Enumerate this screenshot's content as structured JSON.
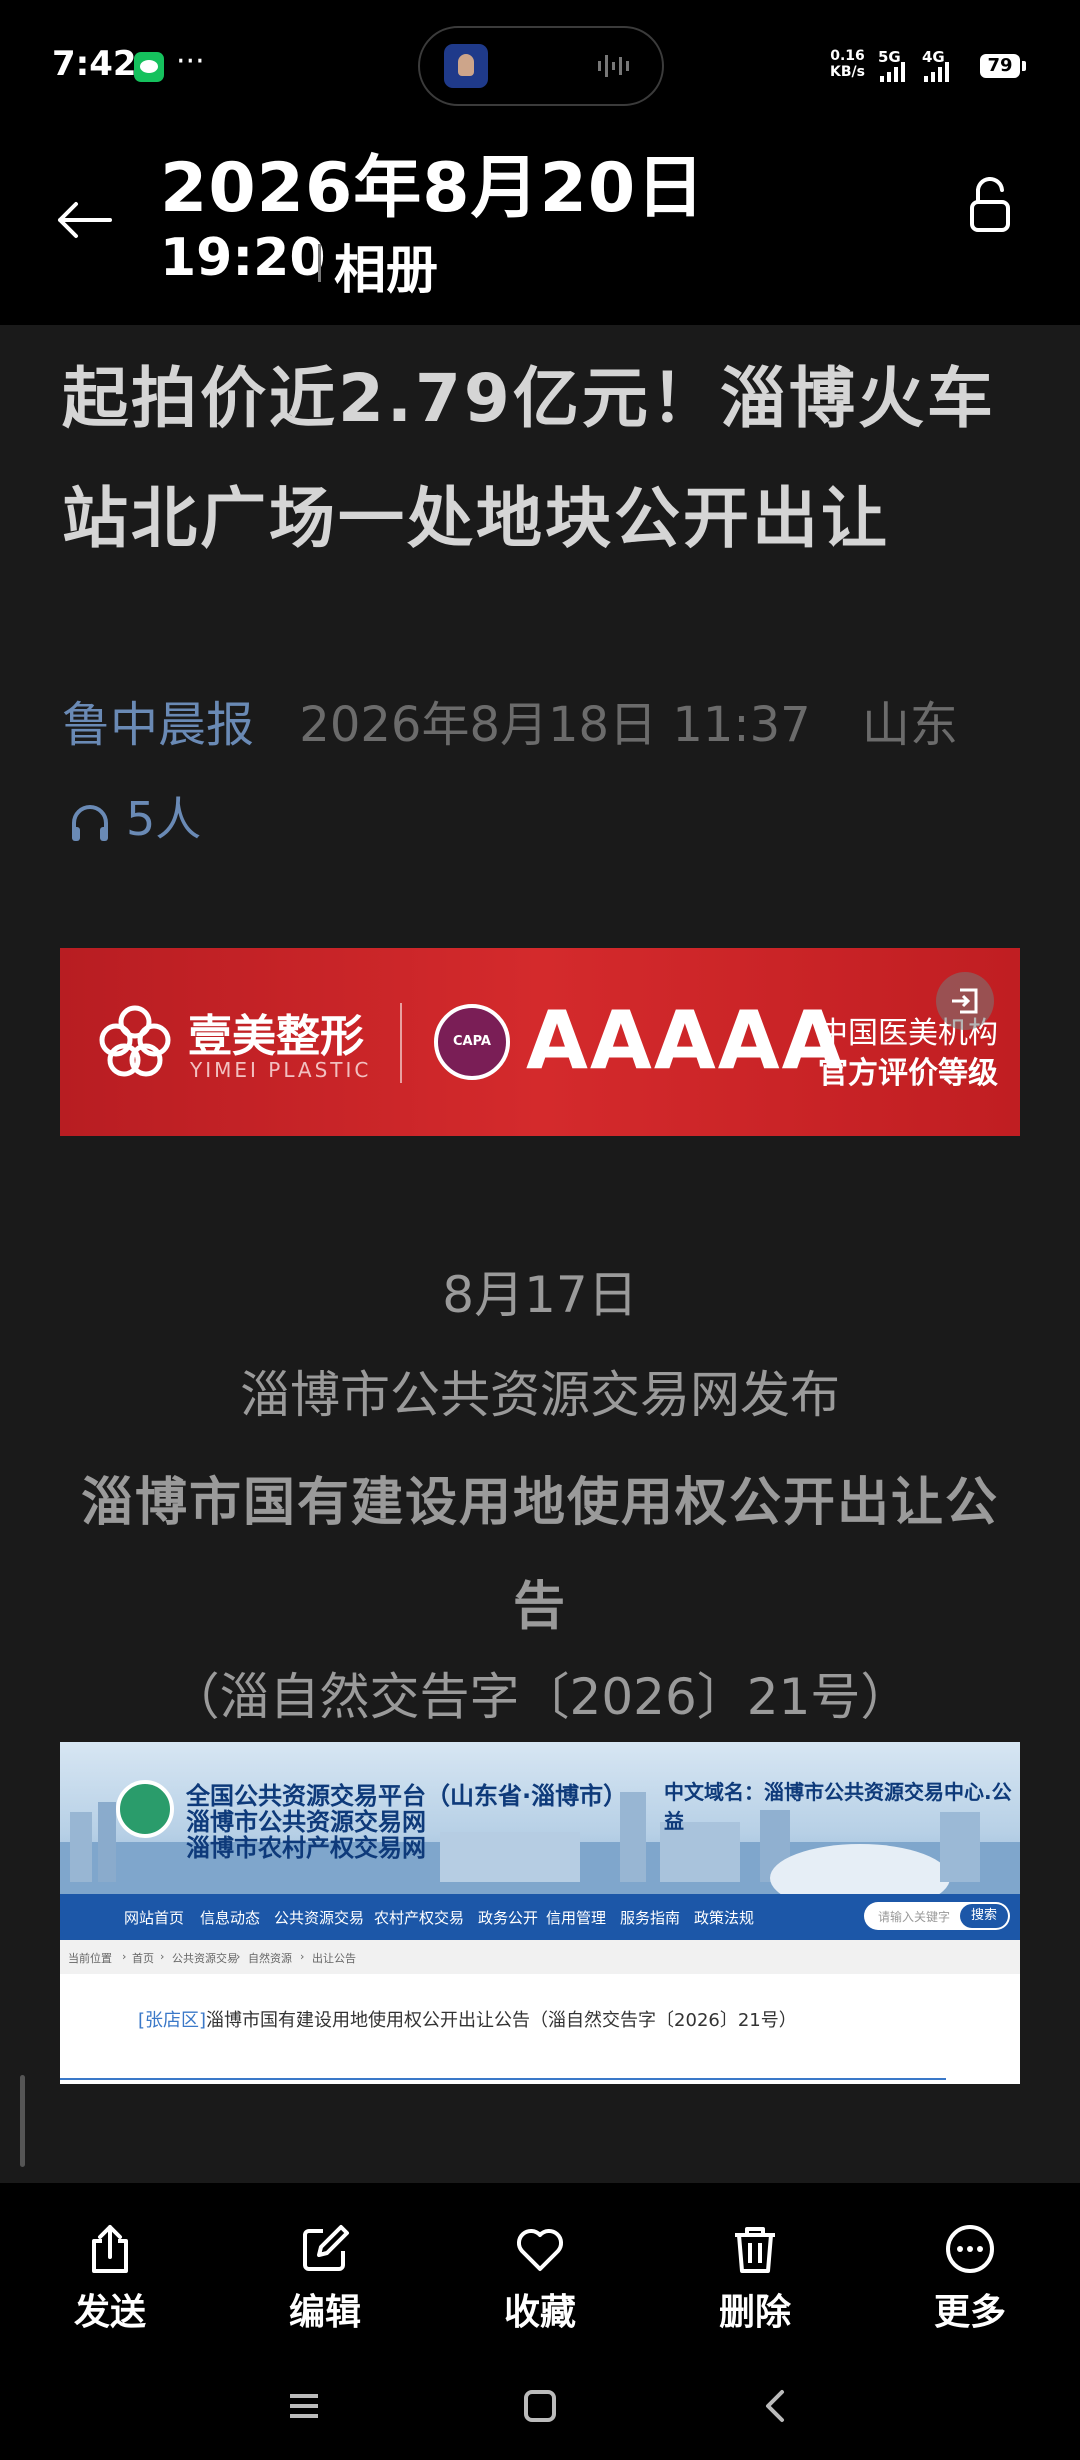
{
  "status_bar": {
    "time": "7:42",
    "more": "···",
    "net_speed_value": "0.16",
    "net_speed_unit": "KB/s",
    "signal_1": "5G",
    "signal_2": "4G",
    "battery": "79"
  },
  "header": {
    "date": "2026年8月20日",
    "time": "19:20",
    "source": "相册"
  },
  "article": {
    "title": "起拍价近2.79亿元！淄博火车站北广场一处地块公开出让",
    "source": "鲁中晨报",
    "date": "2026年8月18日 11:37",
    "region": "山东",
    "listeners": "5人"
  },
  "ad": {
    "brand": "壹美整形",
    "brand_en": "YIMEI PLASTIC",
    "seal": "CAPA",
    "grade": "AAAAA",
    "line1": "中国医美机构",
    "line2": "官方评价等级"
  },
  "body": {
    "date": "8月17日",
    "publisher": "淄博市公共资源交易网发布",
    "notice_title": "淄博市国有建设用地使用权公开出让公告",
    "doc_number": "（淄自然交告字〔2026〕21号）"
  },
  "screenshot": {
    "title_1": "全国公共资源交易平台（山东省·淄博市）",
    "title_2": "淄博市公共资源交易网",
    "title_3": "淄博市农村产权交易网",
    "domain": "中文域名：淄博市公共资源交易中心.公益",
    "nav": [
      "网站首页",
      "信息动态",
      "公共资源交易",
      "农村产权交易",
      "政务公开",
      "信用管理",
      "服务指南",
      "政策法规"
    ],
    "search_placeholder": "请输入关键字",
    "search_button": "搜索",
    "breadcrumb": [
      "当前位置",
      "首页",
      "公共资源交易",
      "自然资源",
      "出让公告"
    ],
    "link_district": "[张店区]",
    "link_text": "淄博市国有建设用地使用权公开出让公告（淄自然交告字〔2026〕21号）"
  },
  "toolbar": {
    "send": "发送",
    "edit": "编辑",
    "favorite": "收藏",
    "delete": "删除",
    "more": "更多"
  },
  "icons": {
    "back": "arrow-left-icon",
    "lock": "unlock-icon",
    "headphones": "headphones-icon"
  }
}
